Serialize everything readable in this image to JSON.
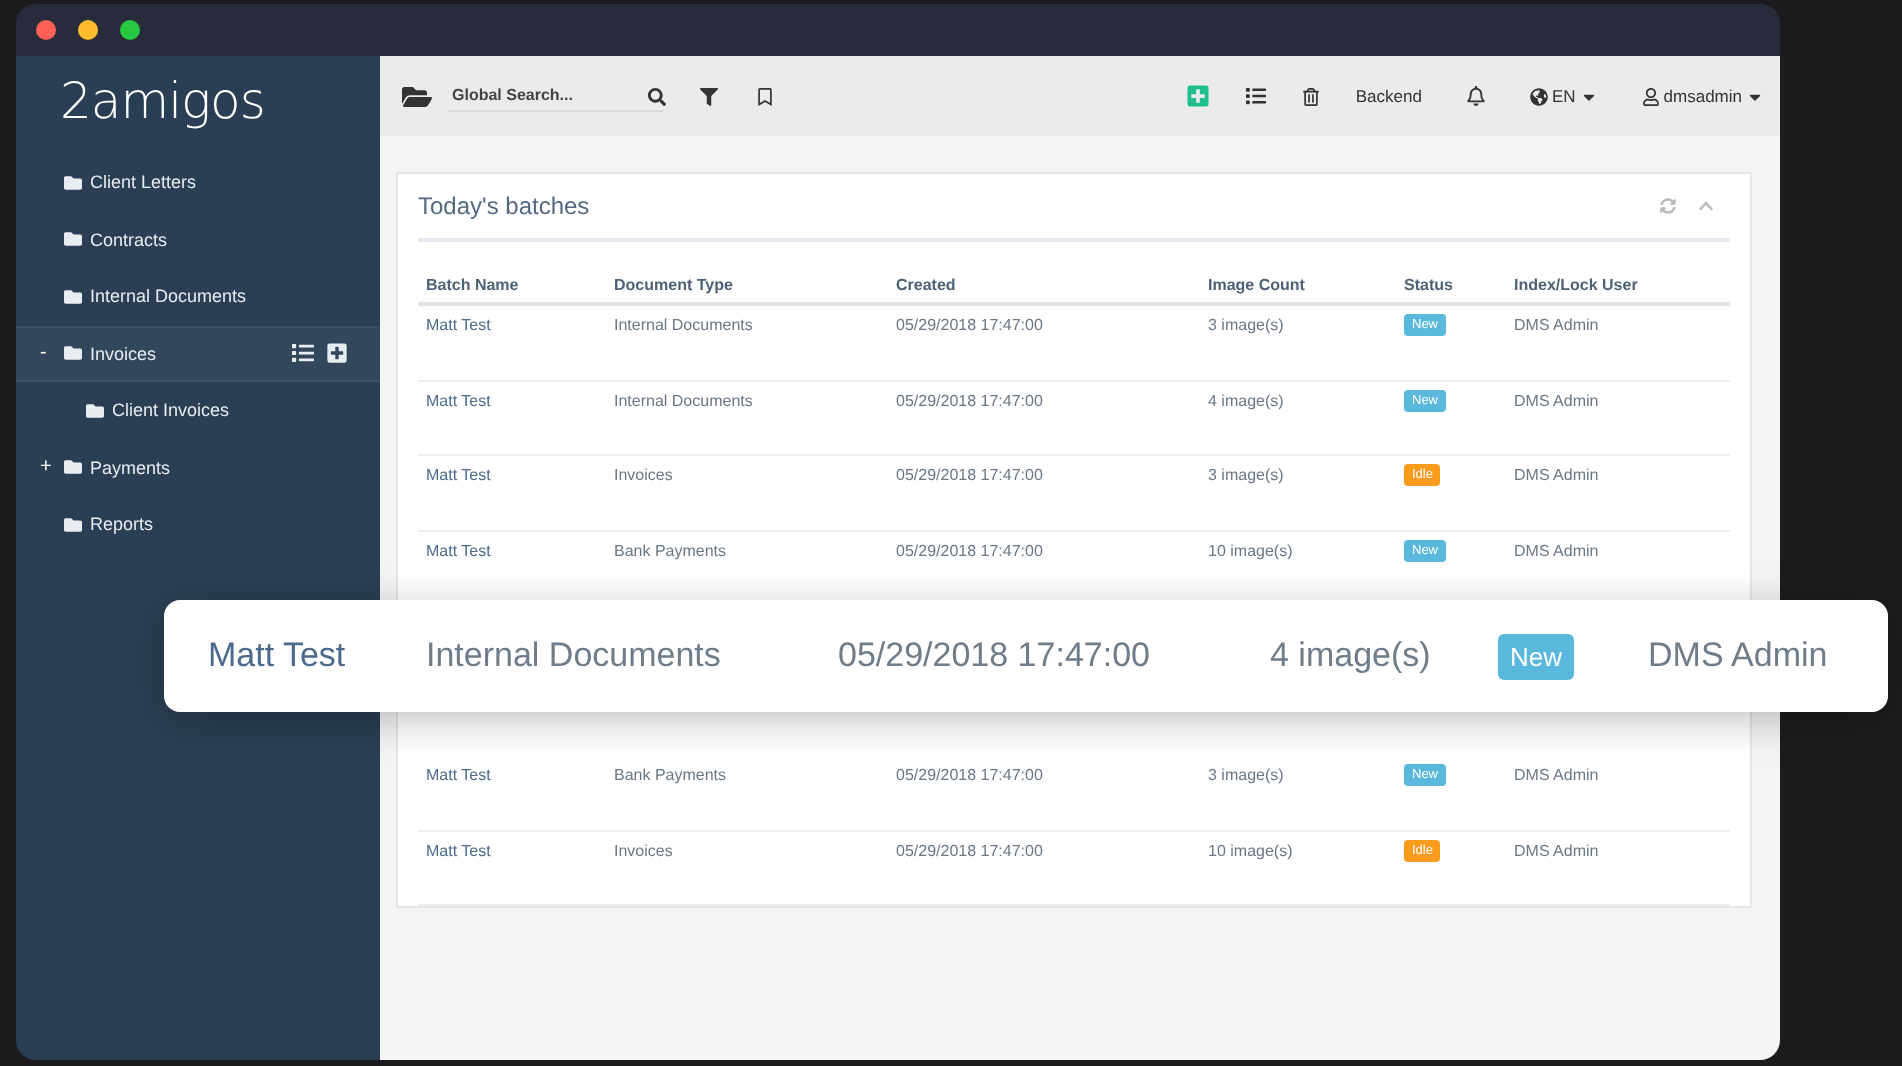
{
  "sidebar": {
    "logo": "2amigos",
    "items": [
      {
        "label": "Client Letters",
        "selected": false
      },
      {
        "label": "Contracts",
        "selected": false
      },
      {
        "label": "Internal Documents",
        "selected": false
      },
      {
        "label": "Invoices",
        "toggle": "-",
        "selected": true,
        "expanded": true,
        "children": [
          {
            "label": "Client Invoices",
            "selected": false
          }
        ]
      },
      {
        "label": "Payments",
        "toggle": "+",
        "selected": false,
        "expanded": false
      },
      {
        "label": "Reports",
        "selected": false
      }
    ]
  },
  "toolbar": {
    "search": {
      "placeholder": "Global Search..."
    },
    "backend": "Backend",
    "language": "EN",
    "user": "dmsadmin"
  },
  "card": {
    "title": "Today's batches",
    "columns": [
      "Batch Name",
      "Document Type",
      "Created",
      "Image Count",
      "Status",
      "Index/Lock User"
    ],
    "rows": [
      {
        "batch": "Matt Test",
        "type": "Internal Documents",
        "created": "05/29/2018 17:47:00",
        "count": "3 image(s)",
        "status": {
          "text": "New",
          "color": "#5bb8dd"
        },
        "user": "DMS Admin"
      },
      {
        "batch": "Matt Test",
        "type": "Internal Documents",
        "created": "05/29/2018 17:47:00",
        "count": "4 image(s)",
        "status": {
          "text": "New",
          "color": "#5bb8dd"
        },
        "user": "DMS Admin"
      },
      {
        "batch": "Matt Test",
        "type": "Invoices",
        "created": "05/29/2018 17:47:00",
        "count": "3 image(s)",
        "status": {
          "text": "Idle",
          "color": "#f99b1c"
        },
        "user": "DMS Admin"
      },
      {
        "batch": "Matt Test",
        "type": "Bank Payments",
        "created": "05/29/2018 17:47:00",
        "count": "10 image(s)",
        "status": {
          "text": "New",
          "color": "#5bb8dd"
        },
        "user": "DMS Admin"
      },
      {
        "batch": "Matt Test",
        "type": "Bank Payments",
        "created": "05/29/2018 17:47:00",
        "count": "3 image(s)",
        "status": {
          "text": "New",
          "color": "#5bb8dd"
        },
        "user": "DMS Admin"
      },
      {
        "batch": "Matt Test",
        "type": "Invoices",
        "created": "05/29/2018 17:47:00",
        "count": "10 image(s)",
        "status": {
          "text": "Idle",
          "color": "#f99b1c"
        },
        "user": "DMS Admin"
      }
    ]
  },
  "highlight": {
    "batch": "Matt Test",
    "type": "Internal Documents",
    "created": "05/29/2018 17:47:00",
    "count": "4 image(s)",
    "status": {
      "text": "New",
      "color": "#5bb8dd"
    },
    "user": "DMS Admin"
  }
}
